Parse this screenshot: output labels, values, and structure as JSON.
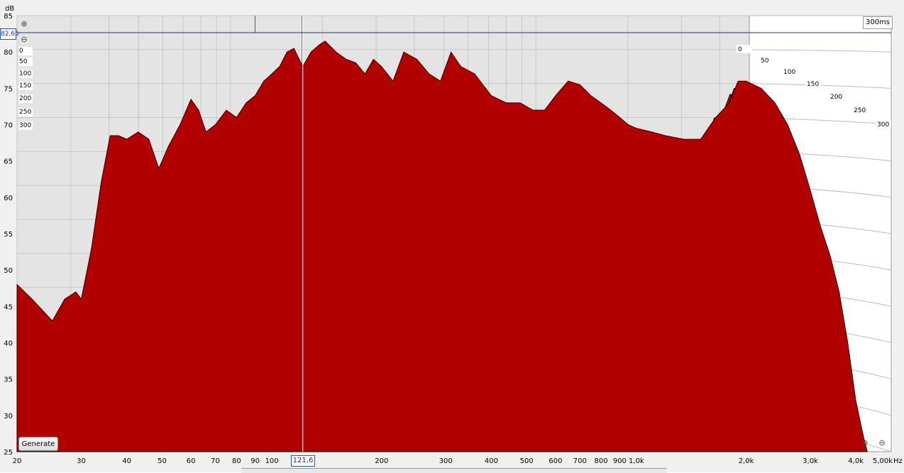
{
  "units": {
    "db": "dB",
    "hz": "Hz"
  },
  "time_readout": "300ms",
  "cursor": {
    "db_label": "82,65",
    "freq_label": "121,6",
    "db_value": 82.65,
    "freq_value": 121.6
  },
  "generate_label": "Generate",
  "icons": [
    "magnify-plus-icon",
    "magnify-minus-icon",
    "zoom-reset-icon"
  ],
  "colors": {
    "fill": "#b00000",
    "line": "#000000",
    "cursor": "#223377",
    "grid": "#c8c8c8"
  },
  "chart_data": {
    "type": "waterfall",
    "xlabel": "Hz",
    "ylabel": "dB",
    "x_scale": "log",
    "xlim": [
      20,
      5000
    ],
    "ylim": [
      25,
      85
    ],
    "x_ticks": [
      {
        "v": 20,
        "t": "20"
      },
      {
        "v": 30,
        "t": "30"
      },
      {
        "v": 40,
        "t": "40"
      },
      {
        "v": 50,
        "t": "50"
      },
      {
        "v": 60,
        "t": "60"
      },
      {
        "v": 70,
        "t": "70"
      },
      {
        "v": 80,
        "t": "80"
      },
      {
        "v": 90,
        "t": "90"
      },
      {
        "v": 100,
        "t": "100"
      },
      {
        "v": 200,
        "t": "200"
      },
      {
        "v": 300,
        "t": "300"
      },
      {
        "v": 400,
        "t": "400"
      },
      {
        "v": 500,
        "t": "500"
      },
      {
        "v": 600,
        "t": "600"
      },
      {
        "v": 700,
        "t": "700"
      },
      {
        "v": 800,
        "t": "800"
      },
      {
        "v": 900,
        "t": "900"
      },
      {
        "v": 1000,
        "t": "1,0k"
      },
      {
        "v": 2000,
        "t": "2,0k"
      },
      {
        "v": 3000,
        "t": "3,0k"
      },
      {
        "v": 4000,
        "t": "4,0k"
      },
      {
        "v": 5000,
        "t": "5,00k"
      }
    ],
    "y_ticks": [
      85,
      80,
      75,
      70,
      65,
      60,
      55,
      50,
      45,
      40,
      35,
      30,
      25
    ],
    "time_ticks_ms": [
      "0",
      "50",
      "100",
      "150",
      "200",
      "250",
      "300"
    ],
    "z_axis_labels": [
      "0",
      "50",
      "100",
      "150",
      "200",
      "250",
      "300"
    ],
    "slice_count": 30,
    "front_slice": {
      "name": "0 ms",
      "points": [
        [
          20,
          48
        ],
        [
          22,
          46
        ],
        [
          25,
          43
        ],
        [
          27,
          46
        ],
        [
          29,
          47
        ],
        [
          30,
          46
        ],
        [
          32,
          53
        ],
        [
          34,
          62
        ],
        [
          36,
          68.5
        ],
        [
          38,
          68.5
        ],
        [
          40,
          68
        ],
        [
          43,
          69
        ],
        [
          46,
          68
        ],
        [
          49,
          64
        ],
        [
          52,
          67
        ],
        [
          56,
          70
        ],
        [
          60,
          73.5
        ],
        [
          63,
          72
        ],
        [
          66,
          69
        ],
        [
          70,
          70
        ],
        [
          75,
          72
        ],
        [
          80,
          71
        ],
        [
          85,
          73
        ],
        [
          90,
          74
        ],
        [
          95,
          76
        ],
        [
          100,
          77
        ],
        [
          105,
          78
        ],
        [
          110,
          80
        ],
        [
          115,
          80.5
        ],
        [
          121.6,
          78
        ],
        [
          128,
          80
        ],
        [
          135,
          81
        ],
        [
          140,
          81.5
        ],
        [
          150,
          80
        ],
        [
          160,
          79
        ],
        [
          170,
          78.5
        ],
        [
          180,
          77
        ],
        [
          190,
          79
        ],
        [
          200,
          78
        ],
        [
          215,
          76
        ],
        [
          230,
          80
        ],
        [
          250,
          79
        ],
        [
          270,
          77
        ],
        [
          290,
          76
        ],
        [
          310,
          80
        ],
        [
          330,
          78
        ],
        [
          360,
          77
        ],
        [
          400,
          74
        ],
        [
          440,
          73
        ],
        [
          480,
          73
        ],
        [
          520,
          72
        ],
        [
          560,
          72
        ],
        [
          600,
          74
        ],
        [
          650,
          76
        ],
        [
          700,
          75.5
        ],
        [
          750,
          74
        ],
        [
          800,
          73
        ],
        [
          850,
          72
        ],
        [
          900,
          71
        ],
        [
          950,
          70
        ],
        [
          1000,
          69.5
        ],
        [
          1100,
          69
        ],
        [
          1200,
          68.5
        ],
        [
          1350,
          68
        ],
        [
          1500,
          68
        ],
        [
          1650,
          71
        ],
        [
          1800,
          73
        ],
        [
          1900,
          76
        ],
        [
          2000,
          76
        ],
        [
          2200,
          75
        ],
        [
          2400,
          73
        ],
        [
          2600,
          70
        ],
        [
          2800,
          66
        ],
        [
          3000,
          61
        ],
        [
          3200,
          56
        ],
        [
          3400,
          52
        ],
        [
          3600,
          47
        ],
        [
          3800,
          40
        ],
        [
          4000,
          32
        ],
        [
          4200,
          27
        ],
        [
          4300,
          25
        ]
      ]
    }
  }
}
